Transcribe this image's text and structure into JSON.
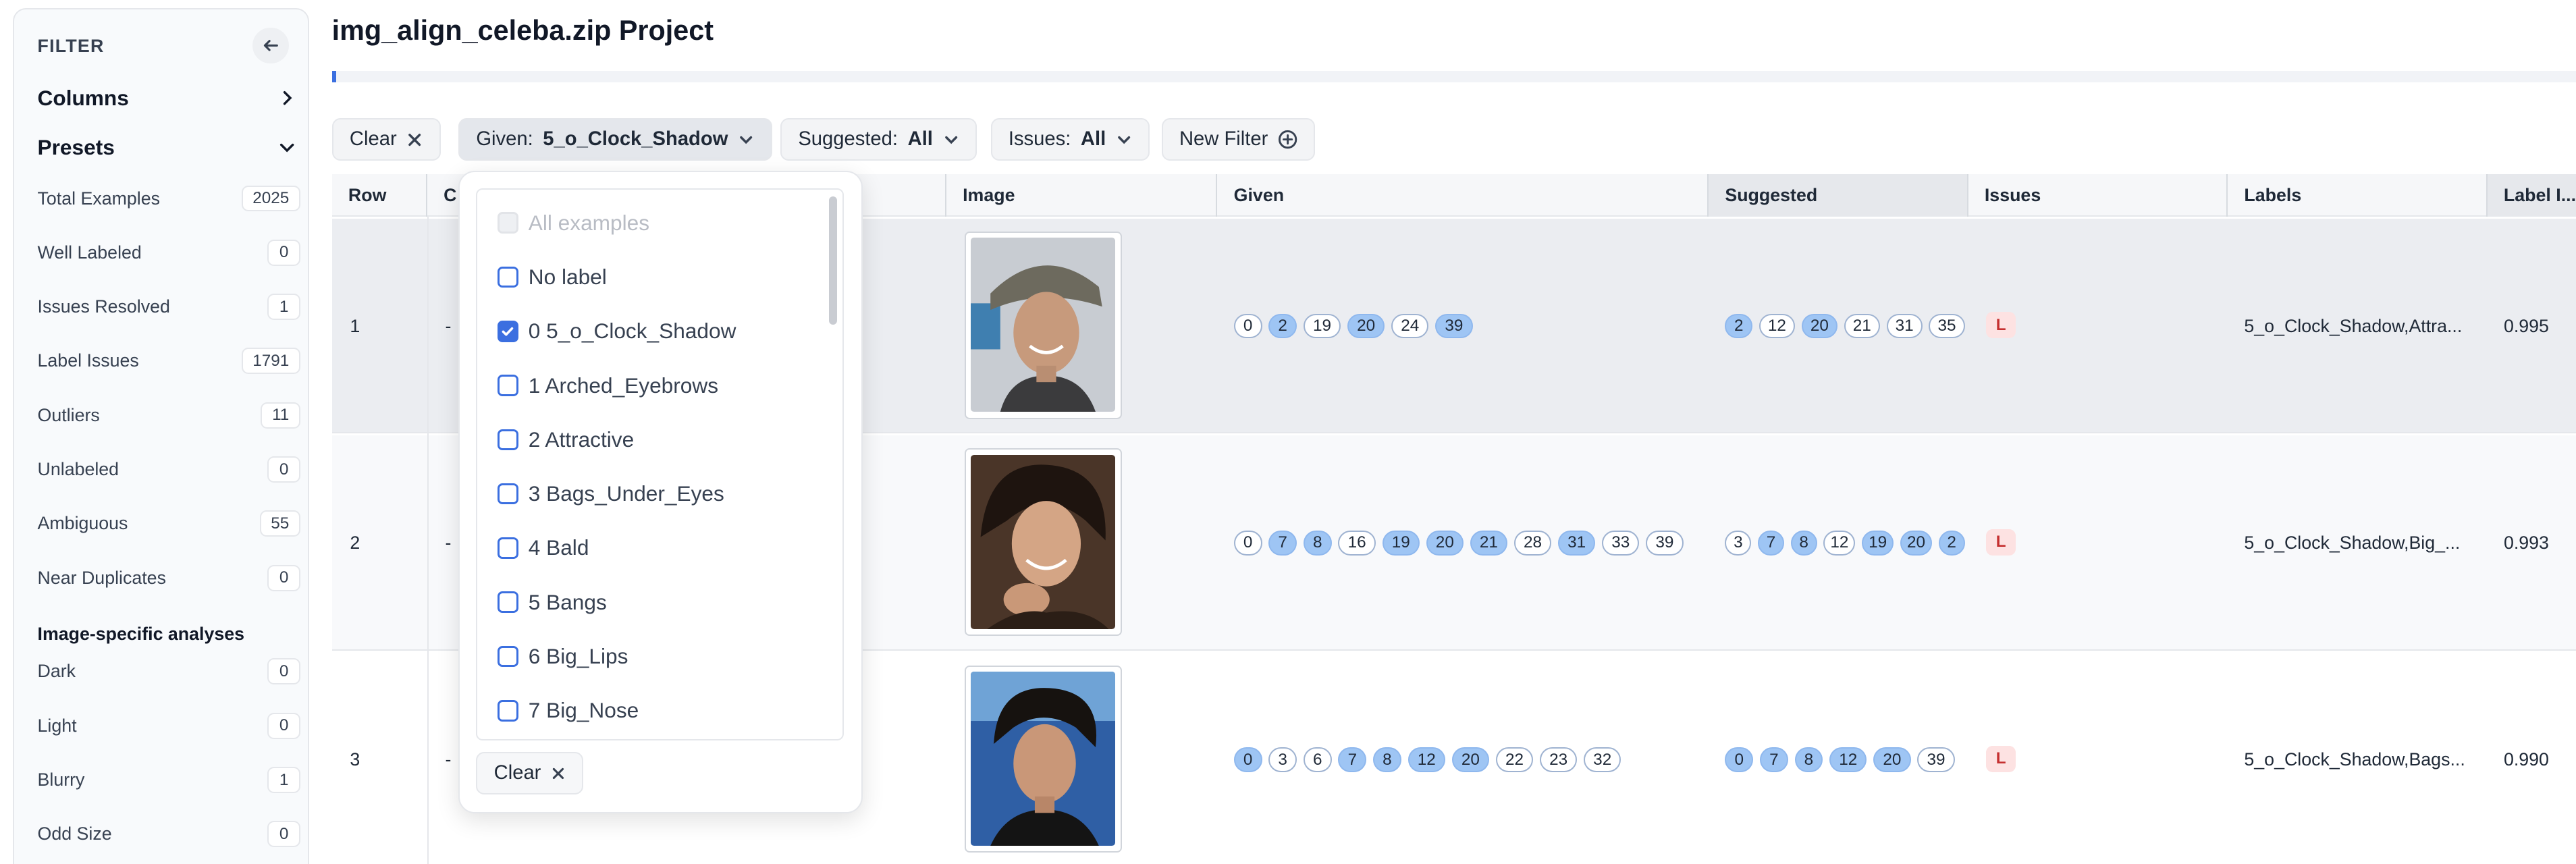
{
  "sidebar": {
    "header": "FILTER",
    "sections": [
      {
        "label": "Columns",
        "expanded": false
      },
      {
        "label": "Presets",
        "expanded": true
      }
    ],
    "presets": [
      {
        "label": "Total Examples",
        "count": "2025"
      },
      {
        "label": "Well Labeled",
        "count": "0"
      },
      {
        "label": "Issues Resolved",
        "count": "1"
      },
      {
        "label": "Label Issues",
        "count": "1791"
      },
      {
        "label": "Outliers",
        "count": "11"
      },
      {
        "label": "Unlabeled",
        "count": "0"
      },
      {
        "label": "Ambiguous",
        "count": "55"
      },
      {
        "label": "Near Duplicates",
        "count": "0"
      }
    ],
    "image_heading": "Image-specific analyses",
    "image_presets": [
      {
        "label": "Dark",
        "count": "0"
      },
      {
        "label": "Light",
        "count": "0"
      },
      {
        "label": "Blurry",
        "count": "1"
      },
      {
        "label": "Odd Size",
        "count": "0"
      }
    ]
  },
  "header": {
    "title": "img_align_celeba.zip Project",
    "progress": 0.002
  },
  "filters": {
    "clear_label": "Clear",
    "given": {
      "label": "Given:",
      "value": "5_o_Clock_Shadow"
    },
    "suggested": {
      "label": "Suggested:",
      "value": "All"
    },
    "issues": {
      "label": "Issues:",
      "value": "All"
    },
    "new_filter_label": "New Filter"
  },
  "table": {
    "columns": [
      "Row",
      "C",
      "Image",
      "Given",
      "Suggested",
      "Issues",
      "Labels",
      "Label I..."
    ],
    "rows": [
      {
        "row": "1",
        "c": "-",
        "given": [
          {
            "v": "0",
            "on": false
          },
          {
            "v": "2",
            "on": true
          },
          {
            "v": "19",
            "on": false
          },
          {
            "v": "20",
            "on": true
          },
          {
            "v": "24",
            "on": false
          },
          {
            "v": "39",
            "on": true
          }
        ],
        "suggested": [
          {
            "v": "2",
            "on": true
          },
          {
            "v": "12",
            "on": false
          },
          {
            "v": "20",
            "on": true
          },
          {
            "v": "21",
            "on": false
          },
          {
            "v": "31",
            "on": false
          },
          {
            "v": "35",
            "on": false
          }
        ],
        "issue": "L",
        "labels": "5_o_Clock_Shadow,Attra...",
        "label_issue": "0.995"
      },
      {
        "row": "2",
        "c": "-",
        "given": [
          {
            "v": "0",
            "on": false
          },
          {
            "v": "7",
            "on": true
          },
          {
            "v": "8",
            "on": true
          },
          {
            "v": "16",
            "on": false
          },
          {
            "v": "19",
            "on": true
          },
          {
            "v": "20",
            "on": true
          },
          {
            "v": "21",
            "on": true
          },
          {
            "v": "28",
            "on": false
          },
          {
            "v": "31",
            "on": true
          },
          {
            "v": "33",
            "on": false
          },
          {
            "v": "39",
            "on": false
          }
        ],
        "suggested": [
          {
            "v": "3",
            "on": false
          },
          {
            "v": "7",
            "on": true
          },
          {
            "v": "8",
            "on": true
          },
          {
            "v": "12",
            "on": false
          },
          {
            "v": "19",
            "on": true
          },
          {
            "v": "20",
            "on": true
          },
          {
            "v": "2",
            "on": true
          }
        ],
        "issue": "L",
        "labels": "5_o_Clock_Shadow,Big_...",
        "label_issue": "0.993"
      },
      {
        "row": "3",
        "c": "-",
        "given": [
          {
            "v": "0",
            "on": true
          },
          {
            "v": "3",
            "on": false
          },
          {
            "v": "6",
            "on": false
          },
          {
            "v": "7",
            "on": true
          },
          {
            "v": "8",
            "on": true
          },
          {
            "v": "12",
            "on": true
          },
          {
            "v": "20",
            "on": true
          },
          {
            "v": "22",
            "on": false
          },
          {
            "v": "23",
            "on": false
          },
          {
            "v": "32",
            "on": false
          }
        ],
        "suggested": [
          {
            "v": "0",
            "on": true
          },
          {
            "v": "7",
            "on": true
          },
          {
            "v": "8",
            "on": true
          },
          {
            "v": "12",
            "on": true
          },
          {
            "v": "20",
            "on": true
          },
          {
            "v": "39",
            "on": false
          }
        ],
        "issue": "L",
        "labels": "5_o_Clock_Shadow,Bags...",
        "label_issue": "0.990"
      }
    ]
  },
  "dropdown": {
    "options": [
      {
        "label": "All examples",
        "checked": false,
        "disabled": true
      },
      {
        "label": "No label",
        "checked": false,
        "disabled": false
      },
      {
        "label": "0 5_o_Clock_Shadow",
        "checked": true,
        "disabled": false
      },
      {
        "label": "1 Arched_Eyebrows",
        "checked": false,
        "disabled": false
      },
      {
        "label": "2 Attractive",
        "checked": false,
        "disabled": false
      },
      {
        "label": "3 Bags_Under_Eyes",
        "checked": false,
        "disabled": false
      },
      {
        "label": "4 Bald",
        "checked": false,
        "disabled": false
      },
      {
        "label": "5 Bangs",
        "checked": false,
        "disabled": false
      },
      {
        "label": "6 Big_Lips",
        "checked": false,
        "disabled": false
      },
      {
        "label": "7 Big_Nose",
        "checked": false,
        "disabled": false
      }
    ],
    "clear_label": "Clear"
  },
  "colors": {
    "accent": "#3b6fe0",
    "pill_on": "#9ec5f4",
    "issue_bg": "#fde2e2",
    "issue_fg": "#c53030"
  }
}
